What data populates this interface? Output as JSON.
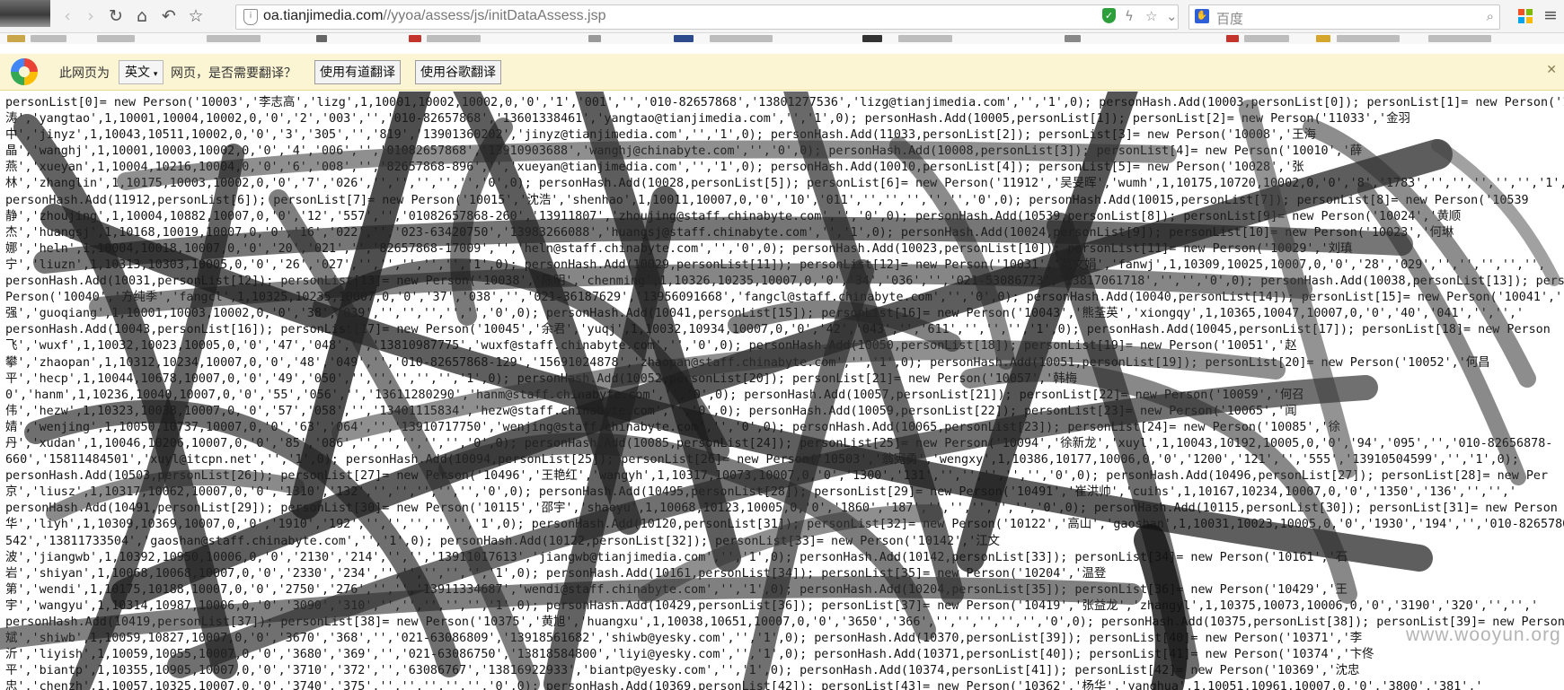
{
  "browser": {
    "url_host": "oa.tianjimedia.com",
    "url_path": "//yyoa/assess/js/initDataAssess.jsp",
    "search_placeholder": "百度"
  },
  "translate_bar": {
    "prefix": "此网页为",
    "language": "英文",
    "suffix": "网页，是否需要翻译？",
    "youdao_button": "使用有道翻译",
    "google_button": "使用谷歌翻译"
  },
  "source_lines": [
    "personList[0]= new Person('10003','李志高','lizg',1,10001,10002,10002,0,'0','1','001','','010-82657868','13801277536','lizg@tianjimedia.com','','1',0); personHash.Add(10003,personList[0]); personList[1]= new Person('1",
    "涛','yangtao',1,10001,10004,10002,0,'0','2','003','','010-82657868','13601338461','yangtao@tianjimedia.com','','1',0); personHash.Add(10005,personList[1]); personList[2]= new Person('11033','金羽",
    "中','jinyz',1,10043,10511,10002,0,'0','3','305','','819','13901360202','jinyz@tianjimedia.com','','1',0); personHash.Add(11033,personList[2]); personList[3]= new Person('10008','王海",
    "晶','wanghj',1,10001,10003,10002,0,'0','4','006','','01082657868','13910903688','wanghj@chinabyte.com','','0',0); personHash.Add(10008,personList[3]); personList[4]= new Person('10010','薛",
    "燕','xueyan',1,10004,10216,10004,0,'0','6','008','','82657868-896','','xueyan@tianjimedia.com','','1',0); personHash.Add(10010,personList[4]); personList[5]= new Person('10028','张",
    "林','zhanglin',1,10175,10003,10002,0,'0','7','026','','','','','','0',0); personHash.Add(10028,personList[5]); personList[6]= new Person('11912','吴旻晖','wumh',1,10175,10720,10002,0,'0','8','1783','','','','','','1',",
    "personHash.Add(11912,personList[6]); personList[7]= new Person('10015','沈浩','shenhao',1,10011,10007,0,'0','10','011','','','','','','0',0); personHash.Add(10015,personList[7]); personList[8]= new Person('10539",
    "静','zhoujing',1,10004,10882,10007,0,'0','12','557','','01082657868-260','13911807','zhoujing@staff.chinabyte.com','','0',0); personHash.Add(10539,personList[8]); personList[9]= new Person('10024','黄顺",
    "杰','huangsj',1,10168,10019,10007,0,'0','16','022','','023-63420750','13983266088','huangsj@staff.chinabyte.com','','1',0); personHash.Add(10024,personList[9]); personList[10]= new Person('10023','何琳",
    "娜','heln',1,10004,10018,10007,0,'0','20','021','','82657868-17009','','heln@staff.chinabyte.com','','0',0); personHash.Add(10023,personList[10]); personList[11]= new Person('10029','刘瑱",
    "宁','liuzn',1,10313,10303,10005,0,'0','26','027','','','','','','1',0); personHash.Add(10029,personList[11]); personList[12]= new Person('10031','范文娟','fanwj',1,10309,10025,10007,0,'0','28','029','','','','','',",
    "personHash.Add(10031,personList[12]); personList[13]= new Person('10038','陈明','chenming',1,10326,10235,10007,0,'0','34','036','','021-53086773','13817061718','','','0',0); personHash.Add(10038,personList[13]); pers",
    "Person('10040','方纯季','fangcl',1,10325,10235,10007,0,'0','37','038','','021-36187629','13956091668','fangcl@staff.chinabyte.com','','0',0); personHash.Add(10040,personList[14]); personList[15]= new Person('10041','",
    "强','guoqiang',1,10001,10003,10002,0,'0','38','039','','','','','','0',0); personHash.Add(10041,personList[15]); personList[16]= new Person('10043','熊荃英','xiongqy',1,10365,10047,10007,0,'0','40','041','','','",
    "personHash.Add(10043,personList[16]); personList[17]= new Person('10045','余君','yuqj',1,10032,10934,10007,0,'0','42','043','','611','','','','1',0); personHash.Add(10045,personList[17]); personList[18]= new Person",
    "飞','wuxf',1,10032,10023,10005,0,'0','47','048','','13810987775','wuxf@staff.chinabyte.com','','0',0); personHash.Add(10050,personList[18]); personList[19]= new Person('10051','赵",
    "攀','zhaopan',1,10312,10234,10007,0,'0','48','049','','010-82657868-129','15691024878','zhaopan@staff.chinabyte.com','','1',0); personHash.Add(10051,personList[19]); personList[20]= new Person('10052','何昌",
    "平','hecp',1,10044,10678,10007,0,'0','49','050','','','','','','1',0); personHash.Add(10052,personList[20]); personList[21]= new Person('10057','韩梅",
    "0','hanm',1,10236,10040,10007,0,'0','55','056','','13611280290','hanm@staff.chinabyte.com','','0',0); personHash.Add(10057,personList[21]); personList[22]= new Person('10059','何召",
    "伟','hezw',1,10323,10038,10007,0,'0','57','058','','13401115834','hezw@staff.chinabyte.com','','0',0); personHash.Add(10059,personList[22]); personList[23]= new Person('10065','闻",
    "婧','wenjing',1,10050,10737,10007,0,'0','63','064','','13910717750','wenjing@staff.chinabyte.com','','0',0); personHash.Add(10065,personList[23]); personList[24]= new Person('10085','徐",
    "丹','xudan',1,10046,10206,10007,0,'0','85','086','','','','','','0',0); personHash.Add(10085,personList[24]); personList[25]= new Person('10094','徐新龙','xuyl',1,10043,10192,10005,0,'0','94','095','','010-82656878-",
    "660','15811484501','xuyl@itcpn.net','','1',0); personHash.Add(10094,personList[25]); personList[26]= new Person('10503','翁宪勇','wengxy',1,10386,10177,10006,0,'0','1200','121','','555','13910504599','','1',0);",
    "personHash.Add(10503,personList[26]); personList[27]= new Person('10496','王艳红','wangyh',1,10317,10073,10007,0,'0','1300','131','','','','','','0',0); personHash.Add(10496,personList[27]); personList[28]= new Per",
    "京','liusz',1,10317,10062,10007,0,'0','1310','132','','','','','','0',0); personHash.Add(10495,personList[28]); personList[29]= new Person('10491','崔洪帅','cuihs',1,10167,10234,10007,0,'0','1350','136','','','",
    "personHash.Add(10491,personList[29]); personList[30]= new Person('10115','邵宇','shaoyu',1,10068,10123,10005,0,'0','1860','187','','','','','','0',0); personHash.Add(10115,personList[30]); personList[31]= new Person",
    "华','liyh',1,10309,10369,10007,0,'0','1910','192','','','','','','1',0); personHash.Add(10120,personList[31]); personList[32]= new Person('10122','高山','gaoshan',1,10031,10023,10005,0,'0','1930','194','','010-8265786",
    "542','13811733504','gaoshan@staff.chinabyte.com','','1',0); personHash.Add(10122,personList[32]); personList[33]= new Person('10142','江文",
    "波','jiangwb',1,10392,10950,10006,0,'0','2130','214','','','13911017613','jiangwb@tianjimedia.com','','1',0); personHash.Add(10142,personList[33]); personList[34]= new Person('10161','石",
    "岩','shiyan',1,10068,10068,10007,0,'0','2330','234','','','','','','1',0); personHash.Add(10161,personList[34]); personList[35]= new Person('10204','温登",
    "第','wendi',1,10175,10188,10007,0,'0','2750','276','','','13911334687','wendi@staff.chinabyte.com','','1',0); personHash.Add(10204,personList[35]); personList[36]= new Person('10429','王",
    "宇','wangyu',1,10314,10987,10006,0,'0','3090','310','','','','','','1',0); personHash.Add(10429,personList[36]); personList[37]= new Person('10419','张益龙','zhangyl',1,10375,10073,10006,0,'0','3190','320','','','",
    "personHash.Add(10419,personList[37]); personList[38]= new Person('10375','黄旭','huangxu',1,10038,10651,10007,0,'0','3650','366','','','','','','0',0); personHash.Add(10375,personList[38]); personList[39]= new Person(",
    "斌','shiwb',1,10059,10827,10007,0,'0','3670','368','','021-63086809','13918561682','shiwb@yesky.com','','1',0); personHash.Add(10370,personList[39]); personList[40]= new Person('10371','李",
    "沂','liyish',1,10059,10055,10007,0,'0','3680','369','','021-63086750','13818584800','liyi@yesky.com','','1',0); personHash.Add(10371,personList[40]); personList[41]= new Person('10374','卞佟",
    "平','biantp',1,10355,10905,10007,0,'0','3710','372','','63086767','13816922933','biantp@yesky.com','','1',0); personHash.Add(10374,personList[41]); personList[42]= new Person('10369','沈忠",
    "忠','chenzh',1,10057,10325,10007,0,'0','3740','375','','','','','','0',0); personHash.Add(10369,personList[42]); personList[43]= new Person('10362','杨华','yanghua',1,10051,10961,10007,0,'0','3800','381','"
  ],
  "watermark": "www.wooyun.org"
}
